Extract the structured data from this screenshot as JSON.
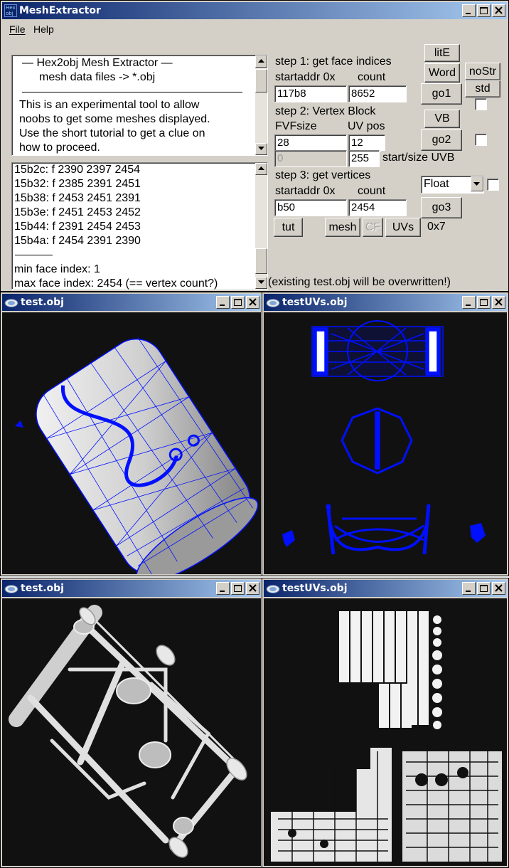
{
  "main_window": {
    "title": "MeshExtractor",
    "app_icon_text": [
      "Hex",
      "obj"
    ],
    "menu": [
      "File",
      "Help"
    ],
    "info": {
      "heading1": "—   Hex2obj Mesh Extractor   —",
      "heading2": "mesh data files -> *.obj",
      "body": [
        "This is an experimental tool to allow",
        "noobs to get some meshes displayed.",
        "Use the short tutorial to get a clue on",
        "how to proceed."
      ]
    },
    "log": {
      "lines": [
        "15b2c: f  2390 2397 2454",
        "15b32: f  2385 2391 2451",
        "15b38: f  2453 2451 2391",
        "15b3e: f  2451 2453 2452",
        "15b44: f  2391 2454 2453",
        "15b4a: f  2454 2391 2390"
      ],
      "min_face": "min face index: 1",
      "max_face": "max face index: 2454 (== vertex count?)"
    },
    "step1": {
      "title": "step 1: get face indices",
      "startaddr_label": "startaddr 0x",
      "count_label": "count",
      "startaddr_value": "117b8",
      "count_value": "8652"
    },
    "step2": {
      "title": "step 2: Vertex Block",
      "fvf_label": "FVFsize",
      "uvpos_label": "UV pos",
      "fvf_value": "28",
      "uvpos_value": "12",
      "uvb_start_value": "0",
      "uvb_size_value": "255",
      "uvb_label": "start/size UVB"
    },
    "step3": {
      "title": "step 3: get vertices",
      "startaddr_label": "startaddr 0x",
      "count_label": "count",
      "startaddr_value": "b50",
      "count_value": "2454",
      "type_selected": "Float"
    },
    "buttons": {
      "lit_e": "litE",
      "word": "Word",
      "no_str": "noStr",
      "go1": "go1",
      "std": "std",
      "vb": "VB",
      "go2": "go2",
      "go3": "go3",
      "tut": "tut",
      "mesh": "mesh",
      "cf": "CF",
      "uvs": "UVs"
    },
    "hex_label": "0x7",
    "status": "(existing test.obj will be overwritten!)"
  },
  "viewer_windows": [
    {
      "title": "test.obj"
    },
    {
      "title": "testUVs.obj"
    },
    {
      "title": "test.obj"
    },
    {
      "title": "testUVs.obj"
    }
  ],
  "colors": {
    "title_bar_start": "#0a246a",
    "title_bar_end": "#a6caf0",
    "window_face": "#d4d0c8",
    "viewport_bg": "#111111",
    "wireframe": "#0010ff",
    "mesh_gray": "#c8c8c8"
  }
}
